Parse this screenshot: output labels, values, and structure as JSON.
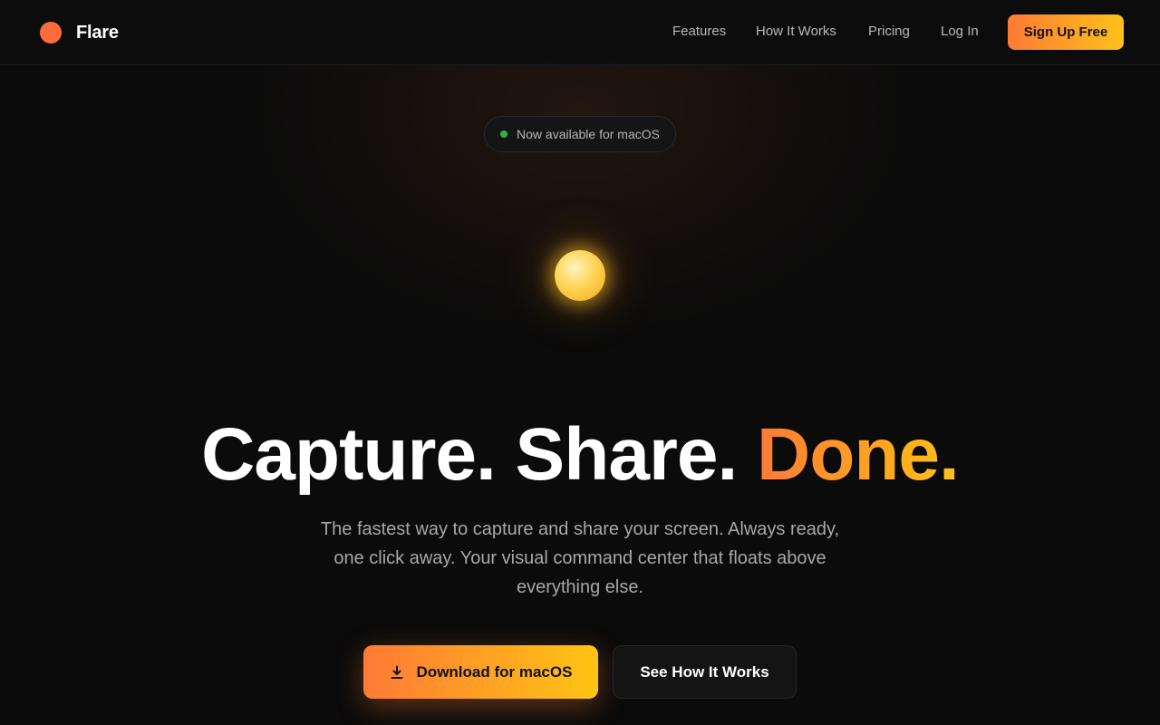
{
  "nav": {
    "brand": "Flare",
    "links": [
      "Features",
      "How It Works",
      "Pricing",
      "Log In"
    ],
    "cta": "Sign Up Free"
  },
  "hero": {
    "badge": "Now available for macOS",
    "headline_part1": "Capture. Share. ",
    "headline_accent": "Done.",
    "subtitle": "The fastest way to capture and share your screen. Always ready, one click away. Your visual command center that floats above everything else.",
    "primary_button": "Download for macOS",
    "secondary_button": "See How It Works"
  },
  "colors": {
    "brand": "#ff6b3d",
    "gradient_start": "#ff7a35",
    "gradient_end": "#ffc21a",
    "status_green": "#2fb24a",
    "background": "#0b0b0b"
  },
  "icons": {
    "brand": "brand-circle-icon",
    "badge": "status-dot-icon",
    "download": "download-icon"
  }
}
